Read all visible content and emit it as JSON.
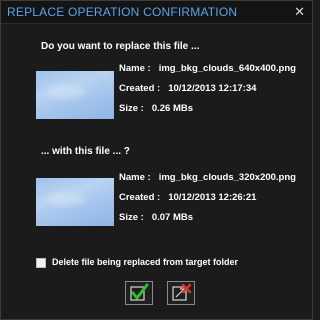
{
  "window": {
    "title": "REPLACE OPERATION CONFIRMATION",
    "close_glyph": "✕"
  },
  "question_replace": "Do you want to replace this file ...",
  "question_with": "... with this file ... ?",
  "target_file": {
    "name_label": "Name :",
    "name": "img_bkg_clouds_640x400.png",
    "created_label": "Created :",
    "created": "10/12/2013 12:17:34",
    "size_label": "Size :",
    "size": "0.26 MBs",
    "thumbnail": "cloud-sky-image"
  },
  "source_file": {
    "name_label": "Name :",
    "name": "img_bkg_clouds_320x200.png",
    "created_label": "Created :",
    "created": "10/12/2013 12:26:21",
    "size_label": "Size :",
    "size": "0.07 MBs",
    "thumbnail": "cloud-sky-image"
  },
  "delete_option": {
    "label": "Delete file being replaced from target folder",
    "checked": false
  },
  "buttons": {
    "confirm_icon": "check-icon",
    "cancel_icon": "cancel-icon"
  },
  "colors": {
    "background": "#1b1b1b",
    "title": "#5aa3e8",
    "confirm": "#2fbf2f",
    "cancel": "#e23030"
  }
}
